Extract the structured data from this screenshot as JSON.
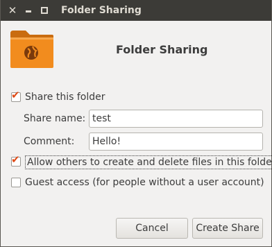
{
  "window": {
    "title": "Folder Sharing",
    "close_glyph": "✕",
    "controls": [
      "close-icon",
      "minimize-icon",
      "maximize-icon"
    ]
  },
  "header": {
    "icon": "folder-share-icon",
    "title": "Folder Sharing",
    "folder_color": "#f28c1e",
    "globe_color": "#7a3a0c"
  },
  "form": {
    "share_folder": {
      "label": "Share this folder",
      "checked": true
    },
    "share_name": {
      "label": "Share name:",
      "value": "test"
    },
    "comment": {
      "label": "Comment:",
      "value": "Hello!"
    },
    "allow_others": {
      "label": "Allow others to create and delete files in this folder",
      "checked": true
    },
    "guest_access": {
      "label": "Guest access (for people without a user account)",
      "checked": false
    },
    "check_glyph": "✔"
  },
  "buttons": {
    "cancel": "Cancel",
    "create_share": "Create Share"
  },
  "colors": {
    "accent": "#df4a16",
    "titlebar": "#3c3b37",
    "background": "#f2f1f0"
  }
}
